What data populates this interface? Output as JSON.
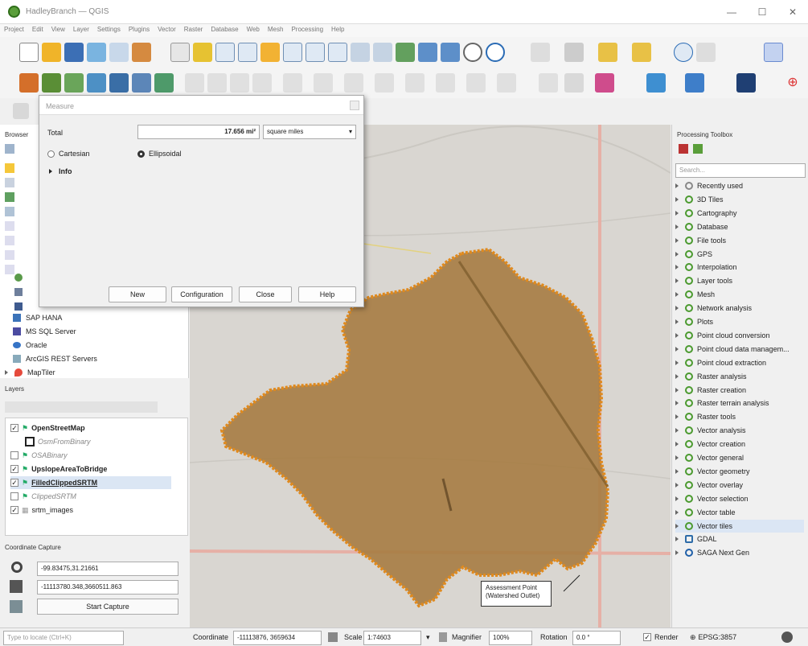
{
  "window": {
    "title": "HadleyBranch — QGIS"
  },
  "menu": [
    "Project",
    "Edit",
    "View",
    "Layer",
    "Settings",
    "Plugins",
    "Vector",
    "Raster",
    "Database",
    "Web",
    "Mesh",
    "Processing",
    "Help"
  ],
  "measure": {
    "title": "Measure",
    "total_label": "Total",
    "total_value": "17.656 mi²",
    "unit": "square miles",
    "cartesian": "Cartesian",
    "ellipsoidal": "Ellipsoidal",
    "info": "Info",
    "buttons": {
      "new": "New",
      "configuration": "Configuration",
      "close": "Close",
      "help": "Help"
    }
  },
  "browser": {
    "title": "Browser",
    "items": [
      "SAP HANA",
      "MS SQL Server",
      "Oracle",
      "ArcGIS REST Servers",
      "MapTiler"
    ]
  },
  "layers": {
    "title": "Layers",
    "items": [
      {
        "name": "OpenStreetMap",
        "checked": true,
        "bold": true,
        "italic": false
      },
      {
        "name": "OsmFromBinary",
        "checked": false,
        "bold": false,
        "italic": true
      },
      {
        "name": "OSABinary",
        "checked": false,
        "bold": false,
        "italic": true
      },
      {
        "name": "UpslopeAreaToBridge",
        "checked": true,
        "bold": true,
        "italic": false
      },
      {
        "name": "FilledClippedSRTM",
        "checked": true,
        "bold": true,
        "italic": false
      },
      {
        "name": "ClippedSRTM",
        "checked": false,
        "bold": false,
        "italic": true
      },
      {
        "name": "srtm_images",
        "checked": true,
        "bold": false,
        "italic": false
      }
    ]
  },
  "coord_capture": {
    "title": "Coordinate Capture",
    "field1": "-99.83475,31.21661",
    "field2": "-11113780.348,3660511.863",
    "start": "Start Capture"
  },
  "toolbox": {
    "title": "Processing Toolbox",
    "search_placeholder": "Search...",
    "items": [
      "Recently used",
      "3D Tiles",
      "Cartography",
      "Database",
      "File tools",
      "GPS",
      "Interpolation",
      "Layer tools",
      "Mesh",
      "Network analysis",
      "Plots",
      "Point cloud conversion",
      "Point cloud data managem...",
      "Point cloud extraction",
      "Raster analysis",
      "Raster creation",
      "Raster terrain analysis",
      "Raster tools",
      "Vector analysis",
      "Vector creation",
      "Vector general",
      "Vector geometry",
      "Vector overlay",
      "Vector selection",
      "Vector table",
      "Vector tiles",
      "GDAL",
      "SAGA Next Gen"
    ]
  },
  "map": {
    "callout": "Assessment Point\n(Watershed Outlet)",
    "polygon_color": "#a57a3f",
    "edge_color": "#e08a1e"
  },
  "status": {
    "locator": "Type to locate (Ctrl+K)",
    "coord_label": "Coordinate",
    "coord": "-11113876, 3659634",
    "scale_label": "Scale",
    "scale": "1:74603",
    "magnifier_label": "Magnifier",
    "magnifier": "100%",
    "rotation_label": "Rotation",
    "rotation": "0.0 °",
    "render": "Render",
    "crs": "EPSG:3857"
  }
}
